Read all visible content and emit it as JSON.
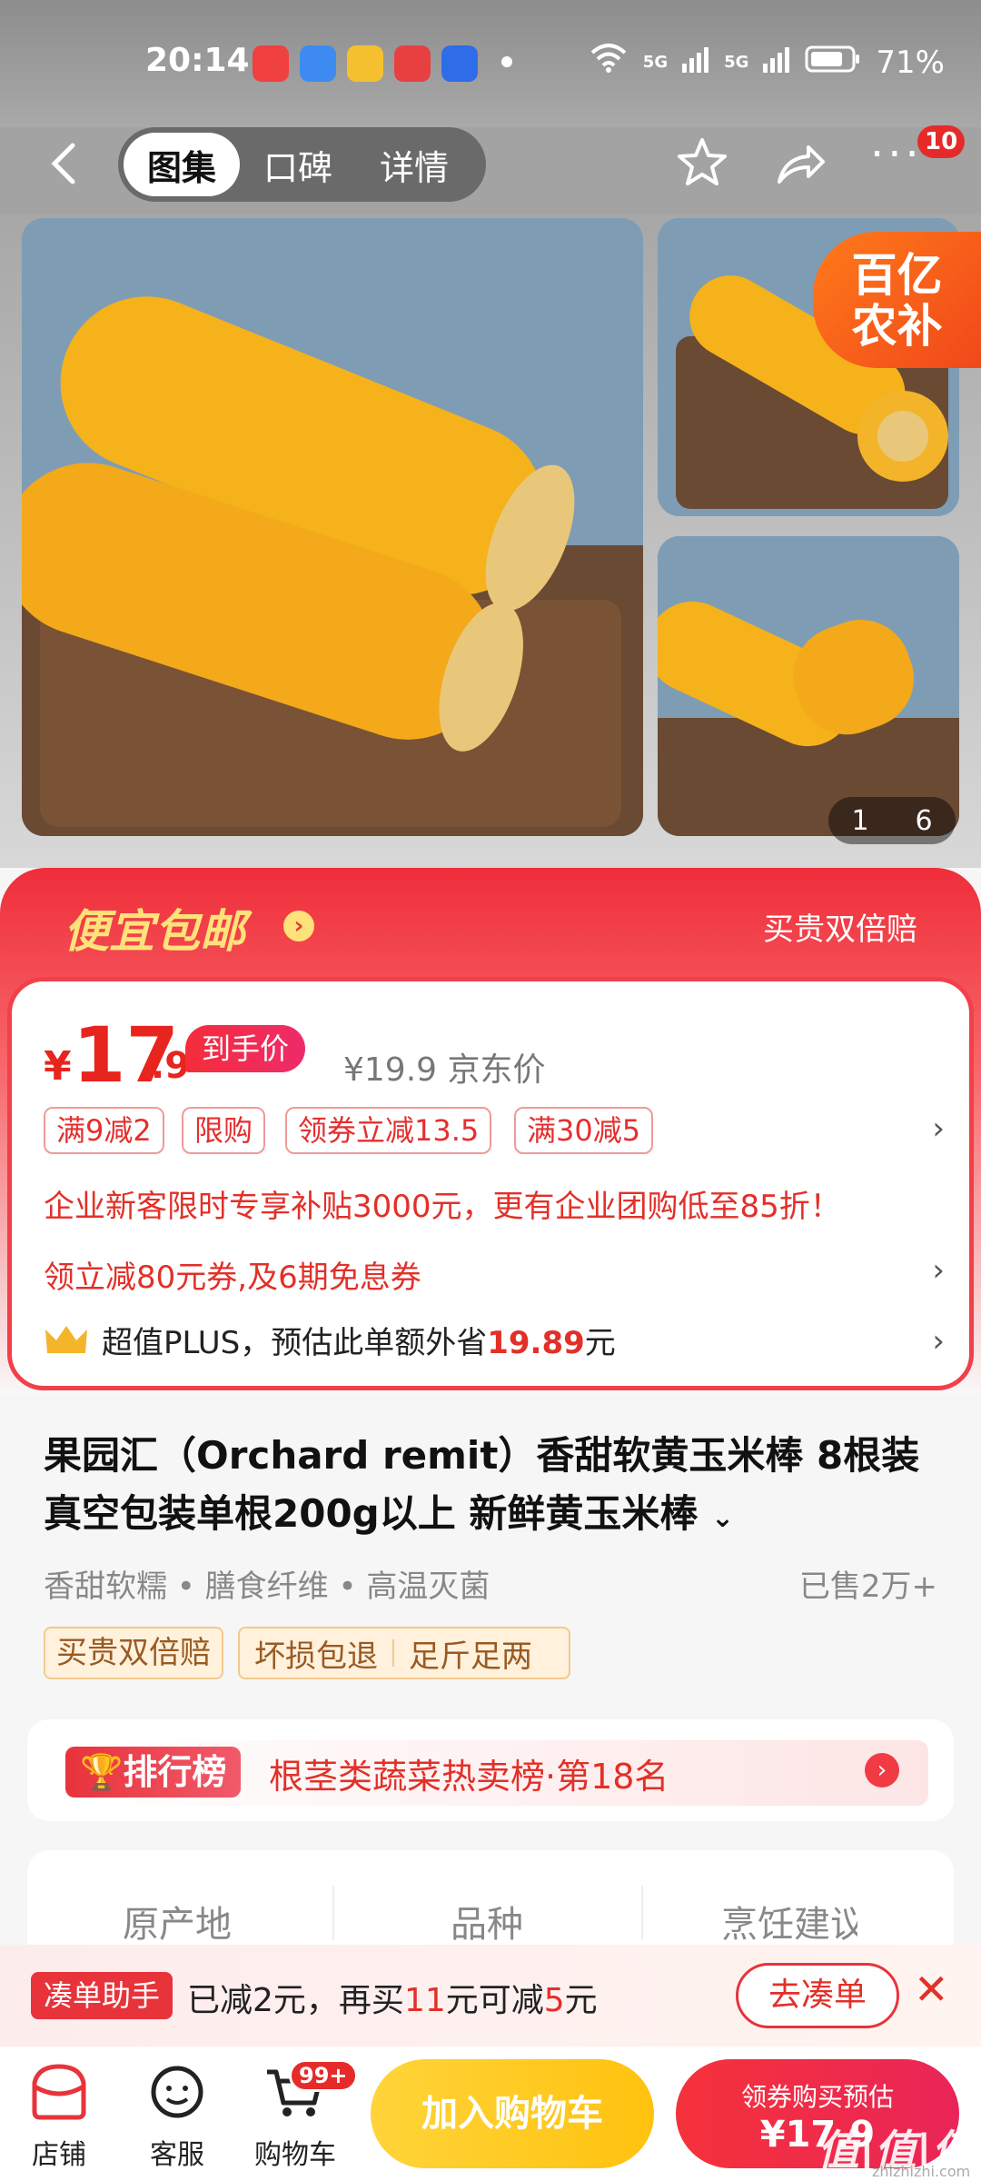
{
  "status": {
    "time": "20:14",
    "net1": "5G",
    "net2": "5G",
    "battery": "71%"
  },
  "nav": {
    "tabs": [
      "图集",
      "口碑",
      "详情"
    ],
    "badge": "10"
  },
  "gallery": {
    "sticker": "百亿\n农补",
    "counter_cur": "1",
    "counter_total": "6"
  },
  "banner": {
    "title": "便宜包邮",
    "right": "买贵双倍赔"
  },
  "price": {
    "yen": "¥",
    "int": "17",
    "dec": ".9",
    "tag": "到手价",
    "original": "¥19.9 京东价",
    "chips": [
      "满9减2",
      "限购",
      "领券立减13.5",
      "满30减5"
    ],
    "enterprise": "企业新客限时专享补贴3000元，更有企业团购低至85折！",
    "coupon": "领立减80元券,及6期免息券",
    "plus_pre": "超值PLUS，预估此单额外省",
    "plus_amt": "19.89",
    "plus_post": "元"
  },
  "product": {
    "title": "果园汇（Orchard remit）香甜软黄玉米棒 8根装真空包装单根200g以上 新鲜黄玉米棒",
    "features": "香甜软糯 • 膳食纤维 • 高温灭菌",
    "sold": "已售2万+",
    "tags": [
      "买贵双倍赔",
      "坏损包退",
      "足斤足两"
    ]
  },
  "rank": {
    "label": "排行榜",
    "text": "根茎类蔬菜热卖榜·第18名"
  },
  "attrs": [
    "原产地",
    "品种",
    "烹饪建议"
  ],
  "helper": {
    "tag": "凑单助手",
    "pre": "已减",
    "a1": "2",
    "mid": "元，再买",
    "a2": "11",
    "mid2": "元可减",
    "a3": "5",
    "post": "元",
    "button": "去凑单"
  },
  "bottom": {
    "store": "店铺",
    "service": "客服",
    "cart": "购物车",
    "cart_badge": "99+",
    "add_cart": "加入购物车",
    "buy_l1": "领券购买预估",
    "buy_l2": "¥17.9",
    "watermark": "值|值|值",
    "watermark_url": "zhizhizhi.com"
  },
  "colors": {
    "accent": "#e8333b",
    "yellow": "#ffc20e",
    "gold": "#ffe27a"
  }
}
